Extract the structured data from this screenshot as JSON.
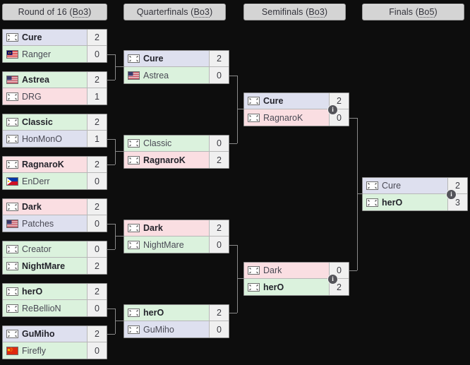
{
  "headers": [
    {
      "label": "Round of 16",
      "format": "Bo3"
    },
    {
      "label": "Quarterfinals",
      "format": "Bo3"
    },
    {
      "label": "Semifinals",
      "format": "Bo3"
    },
    {
      "label": "Finals",
      "format": "Bo5"
    }
  ],
  "colors": {
    "protoss": "#dee0ef",
    "zerg": "#dbf2dd",
    "terran": "#fadee2",
    "background": "#0d0d0d",
    "header_bg": "#d4d4d4",
    "connector": "#8a8a8a",
    "info_bubble": "#54545a"
  },
  "info_label": "i",
  "rounds": [
    {
      "name": "Round of 16",
      "matches": [
        {
          "teams": [
            {
              "name": "Cure",
              "score": "2",
              "race": "protoss",
              "flag": "kr",
              "winner": true
            },
            {
              "name": "Ranger",
              "score": "0",
              "race": "zerg",
              "flag": "my",
              "winner": false
            }
          ],
          "info": false
        },
        {
          "teams": [
            {
              "name": "Astrea",
              "score": "2",
              "race": "zerg",
              "flag": "us",
              "winner": true
            },
            {
              "name": "DRG",
              "score": "1",
              "race": "terran",
              "flag": "kr",
              "winner": false
            }
          ],
          "info": false
        },
        {
          "teams": [
            {
              "name": "Classic",
              "score": "2",
              "race": "zerg",
              "flag": "kr",
              "winner": true
            },
            {
              "name": "HonMonO",
              "score": "1",
              "race": "protoss",
              "flag": "kr",
              "winner": false
            }
          ],
          "info": false
        },
        {
          "teams": [
            {
              "name": "RagnaroK",
              "score": "2",
              "race": "terran",
              "flag": "kr",
              "winner": true
            },
            {
              "name": "EnDerr",
              "score": "0",
              "race": "zerg",
              "flag": "ph",
              "winner": false
            }
          ],
          "info": false
        },
        {
          "teams": [
            {
              "name": "Dark",
              "score": "2",
              "race": "terran",
              "flag": "kr",
              "winner": true
            },
            {
              "name": "Patches",
              "score": "0",
              "race": "protoss",
              "flag": "us",
              "winner": false
            }
          ],
          "info": false
        },
        {
          "teams": [
            {
              "name": "Creator",
              "score": "0",
              "race": "zerg",
              "flag": "kr",
              "winner": false
            },
            {
              "name": "NightMare",
              "score": "2",
              "race": "zerg",
              "flag": "kr",
              "winner": true
            }
          ],
          "info": false
        },
        {
          "teams": [
            {
              "name": "herO",
              "score": "2",
              "race": "zerg",
              "flag": "kr",
              "winner": true
            },
            {
              "name": "ReBellioN",
              "score": "0",
              "race": "zerg",
              "flag": "kr",
              "winner": false
            }
          ],
          "info": false
        },
        {
          "teams": [
            {
              "name": "GuMiho",
              "score": "2",
              "race": "protoss",
              "flag": "kr",
              "winner": true
            },
            {
              "name": "Firefly",
              "score": "0",
              "race": "zerg",
              "flag": "cn",
              "winner": false
            }
          ],
          "info": false
        }
      ]
    },
    {
      "name": "Quarterfinals",
      "matches": [
        {
          "teams": [
            {
              "name": "Cure",
              "score": "2",
              "race": "protoss",
              "flag": "kr",
              "winner": true
            },
            {
              "name": "Astrea",
              "score": "0",
              "race": "zerg",
              "flag": "us",
              "winner": false
            }
          ],
          "info": false
        },
        {
          "teams": [
            {
              "name": "Classic",
              "score": "0",
              "race": "zerg",
              "flag": "kr",
              "winner": false
            },
            {
              "name": "RagnaroK",
              "score": "2",
              "race": "terran",
              "flag": "kr",
              "winner": true
            }
          ],
          "info": false
        },
        {
          "teams": [
            {
              "name": "Dark",
              "score": "2",
              "race": "terran",
              "flag": "kr",
              "winner": true
            },
            {
              "name": "NightMare",
              "score": "0",
              "race": "zerg",
              "flag": "kr",
              "winner": false
            }
          ],
          "info": false
        },
        {
          "teams": [
            {
              "name": "herO",
              "score": "2",
              "race": "zerg",
              "flag": "kr",
              "winner": true
            },
            {
              "name": "GuMiho",
              "score": "0",
              "race": "protoss",
              "flag": "kr",
              "winner": false
            }
          ],
          "info": false
        }
      ]
    },
    {
      "name": "Semifinals",
      "matches": [
        {
          "teams": [
            {
              "name": "Cure",
              "score": "2",
              "race": "protoss",
              "flag": "kr",
              "winner": true
            },
            {
              "name": "RagnaroK",
              "score": "0",
              "race": "terran",
              "flag": "kr",
              "winner": false
            }
          ],
          "info": true
        },
        {
          "teams": [
            {
              "name": "Dark",
              "score": "0",
              "race": "terran",
              "flag": "kr",
              "winner": false
            },
            {
              "name": "herO",
              "score": "2",
              "race": "zerg",
              "flag": "kr",
              "winner": true
            }
          ],
          "info": true
        }
      ]
    },
    {
      "name": "Finals",
      "matches": [
        {
          "teams": [
            {
              "name": "Cure",
              "score": "2",
              "race": "protoss",
              "flag": "kr",
              "winner": false
            },
            {
              "name": "herO",
              "score": "3",
              "race": "zerg",
              "flag": "kr",
              "winner": true
            }
          ],
          "info": true
        }
      ]
    }
  ]
}
